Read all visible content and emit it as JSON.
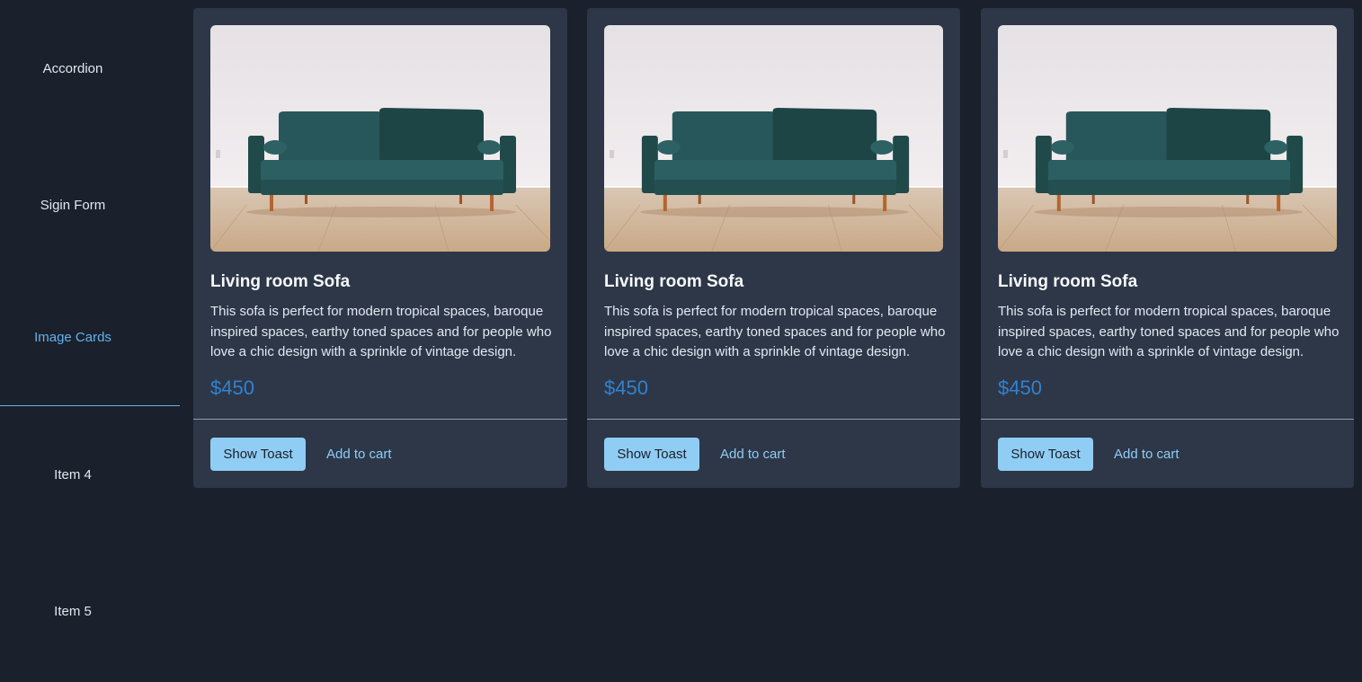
{
  "sidebar": {
    "items": [
      {
        "label": "Accordion"
      },
      {
        "label": "Sigin Form"
      },
      {
        "label": "Image Cards",
        "active": true
      },
      {
        "label": "Item 4"
      },
      {
        "label": "Item 5"
      }
    ]
  },
  "cards": [
    {
      "image_alt": "green sofa",
      "title": "Living room Sofa",
      "description": "This sofa is perfect for modern tropical spaces, baroque inspired spaces, earthy toned spaces and for people who love a chic design with a sprinkle of vintage design.",
      "price": "$450",
      "primary_button": "Show Toast",
      "secondary_button": "Add to cart"
    },
    {
      "image_alt": "green sofa",
      "title": "Living room Sofa",
      "description": "This sofa is perfect for modern tropical spaces, baroque inspired spaces, earthy toned spaces and for people who love a chic design with a sprinkle of vintage design.",
      "price": "$450",
      "primary_button": "Show Toast",
      "secondary_button": "Add to cart"
    },
    {
      "image_alt": "green sofa",
      "title": "Living room Sofa",
      "description": "This sofa is perfect for modern tropical spaces, baroque inspired spaces, earthy toned spaces and for people who love a chic design with a sprinkle of vintage design.",
      "price": "$450",
      "primary_button": "Show Toast",
      "secondary_button": "Add to cart"
    }
  ],
  "colors": {
    "background": "#1a202c",
    "card": "#2d3748",
    "accent": "#63b3ed",
    "price": "#3182ce",
    "button": "#90cdf4"
  }
}
